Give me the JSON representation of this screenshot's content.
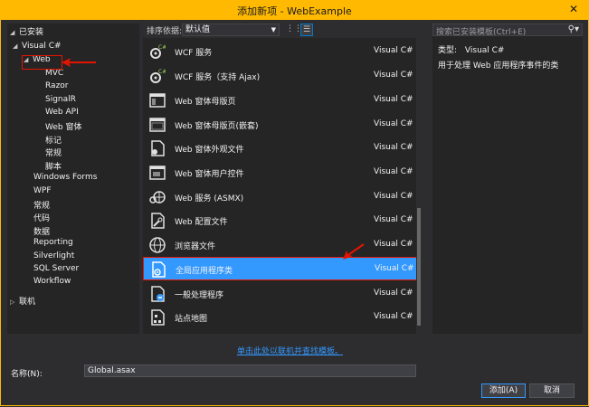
{
  "window": {
    "title": "添加新项 - WebExample",
    "close": "✕"
  },
  "tree": {
    "root": "已安装",
    "visual_csharp": "Visual C#",
    "web": "Web",
    "web_children": [
      "MVC",
      "Razor",
      "SignalR",
      "Web API",
      "Web 窗体",
      "标记",
      "常规",
      "脚本"
    ],
    "siblings": [
      "Windows Forms",
      "WPF",
      "常规",
      "代码",
      "数据",
      "Reporting",
      "Silverlight",
      "SQL Server",
      "Workflow"
    ],
    "online": "联机"
  },
  "toolbar": {
    "sort_label": "排序依据:",
    "sort_value": "默认值"
  },
  "templates": [
    {
      "name": "WCF 服务",
      "lang": "Visual C#",
      "icon": "wcf-service-icon"
    },
    {
      "name": "WCF 服务（支持 Ajax)",
      "lang": "Visual C#",
      "icon": "wcf-ajax-service-icon"
    },
    {
      "name": "Web 窗体母版页",
      "lang": "Visual C#",
      "icon": "master-page-icon"
    },
    {
      "name": "Web 窗体母版页(嵌套)",
      "lang": "Visual C#",
      "icon": "nested-master-page-icon"
    },
    {
      "name": "Web 窗体外观文件",
      "lang": "Visual C#",
      "icon": "skin-file-icon"
    },
    {
      "name": "Web 窗体用户控件",
      "lang": "Visual C#",
      "icon": "user-control-icon"
    },
    {
      "name": "Web 服务 (ASMX)",
      "lang": "Visual C#",
      "icon": "asmx-service-icon"
    },
    {
      "name": "Web 配置文件",
      "lang": "Visual C#",
      "icon": "web-config-icon"
    },
    {
      "name": "浏览器文件",
      "lang": "Visual C#",
      "icon": "browser-file-icon"
    },
    {
      "name": "全局应用程序类",
      "lang": "Visual C#",
      "icon": "global-app-class-icon"
    },
    {
      "name": "一般处理程序",
      "lang": "Visual C#",
      "icon": "generic-handler-icon"
    },
    {
      "name": "站点地图",
      "lang": "Visual C#",
      "icon": "sitemap-icon"
    }
  ],
  "selected_index": 9,
  "search": {
    "placeholder": "搜索已安装模板(Ctrl+E)"
  },
  "description": {
    "type_label": "类型:",
    "type_value": "Visual C#",
    "text": "用于处理 Web 应用程序事件的类"
  },
  "online_link": "单击此处以联机并查找模板。",
  "name_field": {
    "label": "名称(N):",
    "value": "Global.asax"
  },
  "buttons": {
    "add": "添加(A)",
    "cancel": "取消"
  },
  "colors": {
    "title_bar": "#ffb900",
    "selection": "#3399ff",
    "annotation": "#e51400",
    "background": "#2d2d30"
  }
}
